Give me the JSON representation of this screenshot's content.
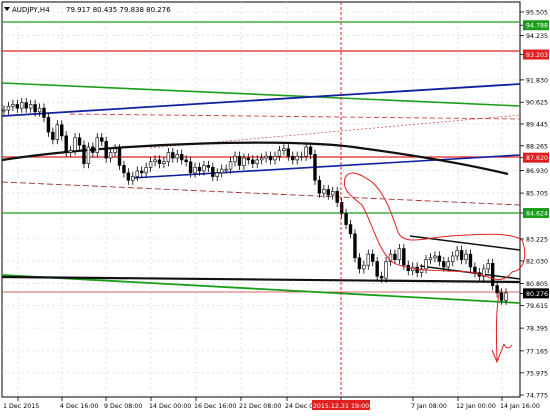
{
  "header": {
    "symbol_timeframe": "AUDJPY,H4",
    "ohlc": "79.917 80.435 79.838 80.276"
  },
  "price_axis": {
    "ticks": [
      "95.505",
      "94.788",
      "94.235",
      "93.203",
      "91.830",
      "90.625",
      "89.445",
      "88.265",
      "87.620",
      "86.930",
      "85.705",
      "84.624",
      "83.225",
      "82.030",
      "80.805",
      "80.276",
      "79.615",
      "78.395",
      "77.165",
      "75.975",
      "74.775"
    ]
  },
  "time_axis": {
    "labels": [
      "1 Dec 2015",
      "4 Dec 16:00",
      "9 Dec 08:00",
      "14 Dec 00:00",
      "16 Dec 16:00",
      "21 Dec 08:00",
      "24 Dec 00:00",
      "2015.12.31 19:00",
      "7 Jan 08:00",
      "12 Jan 00:00",
      "14 Jan 16:00"
    ]
  },
  "levels": {
    "green_top": "94.788",
    "red_top": "93.203",
    "red_mid": "87.620",
    "green_mid": "84.624",
    "current": "80.276"
  },
  "colors": {
    "candle": "#000000",
    "green_line": "#1a9e1a",
    "red_line": "#e02020",
    "blue_line": "#1020a0",
    "black_line": "#111111",
    "cursor_label_bg": "#e02020",
    "current_label_bg": "#000000"
  },
  "chart_data": {
    "type": "candlestick",
    "symbol": "AUDJPY",
    "timeframe": "H4",
    "last_bar": {
      "open": 79.917,
      "high": 80.435,
      "low": 79.838,
      "close": 80.276
    },
    "ylim": [
      74.775,
      95.505
    ],
    "path_prices": [
      90.2,
      90.4,
      90.5,
      90.3,
      90.6,
      90.3,
      90.5,
      90.1,
      90.3,
      89.8,
      89.0,
      88.6,
      89.4,
      88.8,
      87.9,
      88.0,
      88.7,
      88.3,
      87.3,
      88.2,
      87.9,
      88.7,
      88.5,
      87.6,
      87.9,
      88.1,
      87.2,
      86.8,
      86.4,
      86.6,
      86.9,
      86.8,
      87.1,
      87.4,
      87.5,
      87.3,
      87.4,
      87.9,
      87.6,
      87.8,
      87.5,
      87.4,
      86.8,
      87.1,
      86.9,
      87.2,
      87.1,
      86.6,
      86.8,
      87.0,
      87.0,
      87.4,
      87.7,
      87.2,
      87.6,
      87.5,
      87.3,
      87.5,
      87.6,
      87.7,
      87.5,
      87.7,
      88.0,
      88.1,
      87.7,
      87.5,
      87.7,
      87.7,
      88.2,
      87.8,
      86.4,
      85.7,
      85.9,
      85.6,
      85.8,
      85.2,
      84.6,
      84.0,
      83.5,
      82.2,
      81.6,
      81.8,
      82.4,
      82.0,
      81.2,
      81.1,
      82.0,
      82.4,
      82.1,
      82.7,
      81.8,
      81.5,
      81.7,
      81.4,
      81.6,
      82.1,
      82.2,
      82.3,
      82.0,
      81.7,
      82.0,
      82.3,
      82.6,
      82.1,
      82.4,
      81.7,
      81.4,
      81.2,
      81.6,
      81.9,
      80.7,
      80.3,
      79.9,
      80.3
    ],
    "annotations": [
      "red freehand outline",
      "red arrow down",
      "trend channels",
      "horizontal support/resistance lines"
    ]
  }
}
